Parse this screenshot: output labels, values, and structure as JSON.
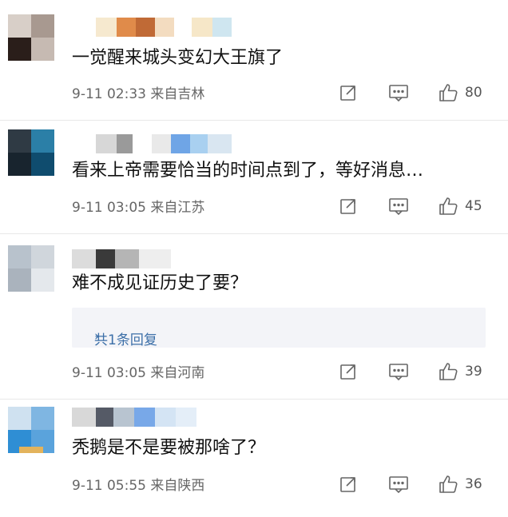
{
  "comments": [
    {
      "text": "一觉醒来城头变幻大王旗了",
      "time": "9-11 02:33",
      "location": "来自吉林",
      "likes": "80",
      "avatar_colors": [
        "#d8cfc8",
        "#7a6a62",
        "#c6bab2",
        "#f1ece8"
      ],
      "name_colors": [
        "#f6e9cf",
        "#e08b4a",
        "#c06a36",
        "#f3dcc0",
        "#f6e7c8",
        "#cfe6f0"
      ]
    },
    {
      "text": "看来上帝需要恰当的时间点到了，等好消息…",
      "time": "9-11 03:05",
      "location": "来自江苏",
      "likes": "45",
      "avatar_colors": [
        "#2f3a44",
        "#2b7fa7",
        "#0f4c6e",
        "#18242e"
      ],
      "name_colors": [
        "#d7d7d7",
        "#9a9a9a",
        "#e9e9e9",
        "#6fa5e6",
        "#a9d0f0",
        "#d9e6f1"
      ]
    },
    {
      "text": "难不成见证历史了要？",
      "time": "9-11 03:05",
      "location": "来自河南",
      "likes": "39",
      "reply_label": "共1条回复",
      "reply_arrow": "›",
      "avatar_colors": [
        "#b8c2cc",
        "#d0d6dc",
        "#aab3bd",
        "#e4e8ec"
      ],
      "name_colors": [
        "#dcdcdc",
        "#3a3a3a",
        "#b5b5b5",
        "#eeeeee"
      ]
    },
    {
      "text": "秃鹅是不是要被那啥了？",
      "time": "9-11 05:55",
      "location": "来自陕西",
      "likes": "36",
      "avatar_colors": [
        "#7fb6e2",
        "#2f8ed4",
        "#e3b35c",
        "#cfe1f0"
      ],
      "name_colors": [
        "#d8d8d8",
        "#555a66",
        "#b8c4d0",
        "#78a8e8",
        "#d4e4f4"
      ]
    }
  ],
  "icons": {
    "share": "share-edit-icon",
    "comment": "comment-bubble-icon",
    "like": "thumbs-up-icon"
  },
  "colors": {
    "text": "#111111",
    "meta": "#666666",
    "reply_link": "#3c6fa8",
    "reply_bg": "#f3f4f8",
    "divider": "#e8e8e8"
  }
}
